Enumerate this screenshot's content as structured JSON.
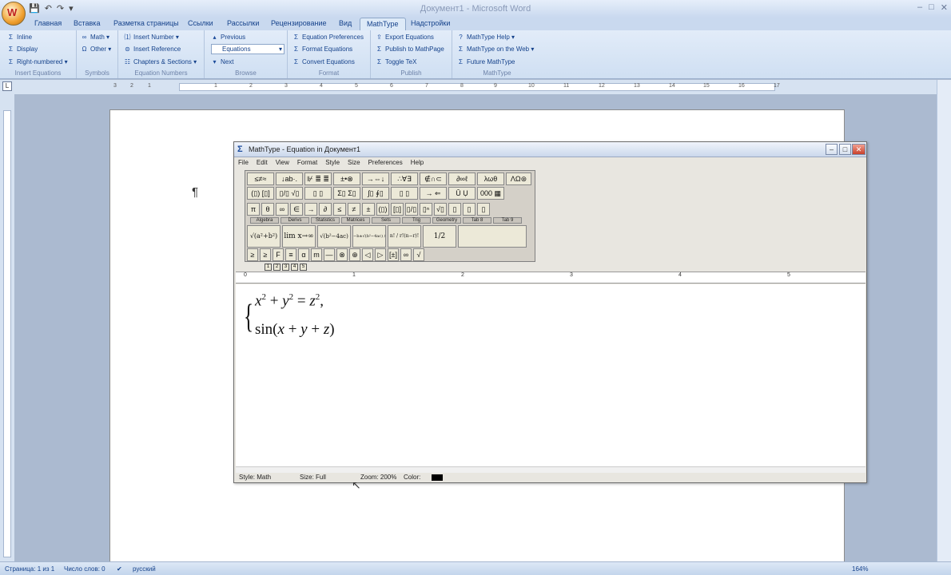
{
  "window": {
    "title": "Документ1 - Microsoft Word",
    "office_button_glyph": "W"
  },
  "qat": {
    "save": "💾",
    "undo": "↶",
    "redo": "↷",
    "more": "▾"
  },
  "controls": {
    "minimize": "–",
    "maximize": "□",
    "close": "✕"
  },
  "tabs": [
    {
      "label": "Главная"
    },
    {
      "label": "Вставка"
    },
    {
      "label": "Разметка страницы"
    },
    {
      "label": "Ссылки"
    },
    {
      "label": "Рассылки"
    },
    {
      "label": "Рецензирование"
    },
    {
      "label": "Вид"
    },
    {
      "label": "MathType"
    },
    {
      "label": "Надстройки"
    }
  ],
  "ribbon": {
    "insert_equations": {
      "label": "Insert Equations",
      "inline": "Inline",
      "display": "Display",
      "right_numbered": "Right-numbered ▾"
    },
    "symbols": {
      "label": "Symbols",
      "math": "Math ▾",
      "other": "Other ▾"
    },
    "equation_numbers": {
      "label": "Equation Numbers",
      "insert_number": "Insert Number ▾",
      "insert_reference": "Insert Reference",
      "chapters": "Chapters & Sections ▾"
    },
    "browse": {
      "label": "Browse",
      "previous": "Previous",
      "field_value": "Equations",
      "next": "Next"
    },
    "format": {
      "label": "Format",
      "prefs": "Equation Preferences",
      "format_eq": "Format Equations",
      "convert": "Convert Equations"
    },
    "publish": {
      "label": "Publish",
      "export": "Export Equations",
      "publish_page": "Publish to MathPage",
      "toggle_tex": "Toggle TeX"
    },
    "mathtype": {
      "label": "MathType",
      "help": "MathType Help ▾",
      "web": "MathType on the Web ▾",
      "future": "Future MathType"
    }
  },
  "ruler": {
    "numbers": [
      "3",
      "2",
      "1",
      "1",
      "2",
      "3",
      "4",
      "5",
      "6",
      "7",
      "8",
      "9",
      "10",
      "11",
      "12",
      "13",
      "14",
      "15",
      "16",
      "17"
    ]
  },
  "document": {
    "pilcrow": "¶"
  },
  "status": {
    "page": "Страница: 1 из 1",
    "words": "Число слов: 0",
    "language": "русский",
    "zoom": "164%"
  },
  "mathtype": {
    "title": "MathType - Equation in Документ1",
    "menu": [
      "File",
      "Edit",
      "View",
      "Format",
      "Style",
      "Size",
      "Preferences",
      "Help"
    ],
    "palette_row1": [
      "≤≠≈",
      "↓ab·.",
      "⊮ ≣ ≣",
      "±•⊗",
      "→⇔↓",
      "∴∀∃",
      "∉∩⊂",
      "∂∞ℓ",
      "λωθ",
      "ΛΩ⊛"
    ],
    "palette_row2": [
      "(▯) [▯]",
      "▯/▯ √▯",
      "▯ ▯",
      "Σ▯ Σ▯",
      "∫▯ ∮▯",
      "▯ ▯",
      "→ ⇐",
      "Ū Ụ",
      "000 ▦"
    ],
    "palette_row3": [
      "π",
      "θ",
      "∞",
      "∈",
      "→",
      "∂",
      "≤",
      "≠",
      "±",
      "(▯)",
      "[▯]",
      "▯/▯",
      "▯ⁿ",
      "√▯",
      "▯",
      "▯",
      "▯"
    ],
    "palette_tabs": [
      "Algebra",
      "Derivs",
      "Statistics",
      "Matrices",
      "Sets",
      "Trig",
      "Geometry",
      "Tab 8",
      "Tab 9"
    ],
    "palette_big": [
      "√(a²+b²)",
      "lim x→∞",
      "√(b²−4ac)",
      "−b±√(b²−4ac) / 2a",
      "n! / r!(n−r)!",
      "1/2"
    ],
    "palette_row5": [
      "≥",
      "≥",
      "F",
      "≡",
      "α",
      "m",
      "—",
      "⊗",
      "⊕",
      "◁",
      "▷",
      "[±]",
      "∞",
      "√"
    ],
    "tabbar": [
      "1",
      "2",
      "3",
      "4",
      "5"
    ],
    "ruler": [
      "0",
      "1",
      "2",
      "3",
      "4",
      "5"
    ],
    "equation": {
      "line1_html": "<i>x</i><sup>2</sup> + <i>y</i><sup>2</sup> = <i>z</i><sup>2</sup>,",
      "line2_html": "sin(<i>x</i> + <i>y</i> + <i>z</i>)"
    },
    "status": {
      "style": "Style: Math",
      "size": "Size: Full",
      "zoom": "Zoom: 200%",
      "color": "Color:"
    }
  }
}
